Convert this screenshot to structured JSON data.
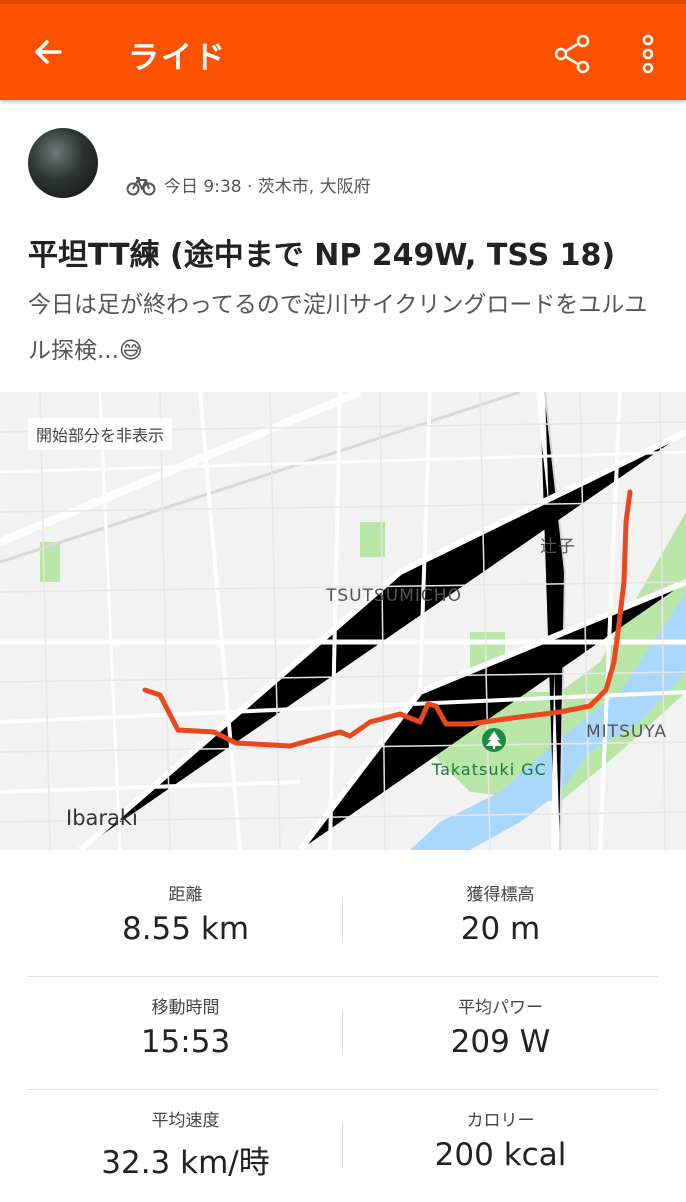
{
  "appbar": {
    "title": "ライド",
    "back_icon": "arrow-left-icon",
    "share_icon": "share-icon",
    "more_icon": "more-vert-icon",
    "color": "#fc5200"
  },
  "athlete": {
    "time": "今日 9:38 · 茨木市, 大阪府",
    "activity_icon": "bike-icon"
  },
  "activity": {
    "title": "平坦TT練 (途中まで NP 249W, TSS 18)",
    "description": "今日は足が終わってるので淀川サイクリングロードをユルユル探検...😅"
  },
  "map": {
    "hide_start_label": "開始部分を非表示",
    "labels": {
      "tsujiko": "辻子",
      "tsutsumicho": "TSUTSUMICHO",
      "mitsuya": "MITSUYA",
      "takatsuki_gc": "Takatsuki GC",
      "ibaraki": "Ibaraki"
    },
    "route_color": "#e8481c",
    "water_color": "#aadaff",
    "park_color": "#b5e4a2"
  },
  "stats": [
    [
      {
        "label": "距離",
        "value": "8.55 km"
      },
      {
        "label": "獲得標高",
        "value": "20 m"
      }
    ],
    [
      {
        "label": "移動時間",
        "value": "15:53"
      },
      {
        "label": "平均パワー",
        "value": "209 W"
      }
    ],
    [
      {
        "label": "平均速度",
        "value": "32.3 km/時"
      },
      {
        "label": "カロリー",
        "value": "200 kcal"
      }
    ]
  ]
}
